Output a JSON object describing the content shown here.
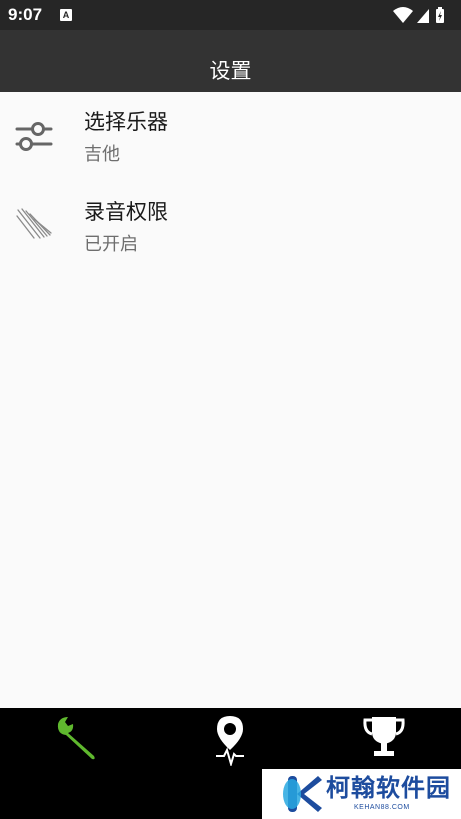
{
  "status_bar": {
    "time": "9:07",
    "notification_letter": "A"
  },
  "app_bar": {
    "title": "设置"
  },
  "settings": [
    {
      "title": "选择乐器",
      "subtitle": "吉他",
      "icon": "sliders-icon"
    },
    {
      "title": "录音权限",
      "subtitle": "已开启",
      "icon": "microphone-lines-icon"
    }
  ],
  "bottom_nav": {
    "tabs": [
      {
        "icon": "wrench-icon",
        "active": true
      },
      {
        "icon": "tuner-pin-icon",
        "active": false
      },
      {
        "icon": "trophy-icon",
        "active": false
      }
    ],
    "active_color": "#5fb82e",
    "inactive_color": "#ffffff"
  },
  "watermark": {
    "text": "柯翰软件园",
    "sub": "KEHAN88.COM"
  }
}
